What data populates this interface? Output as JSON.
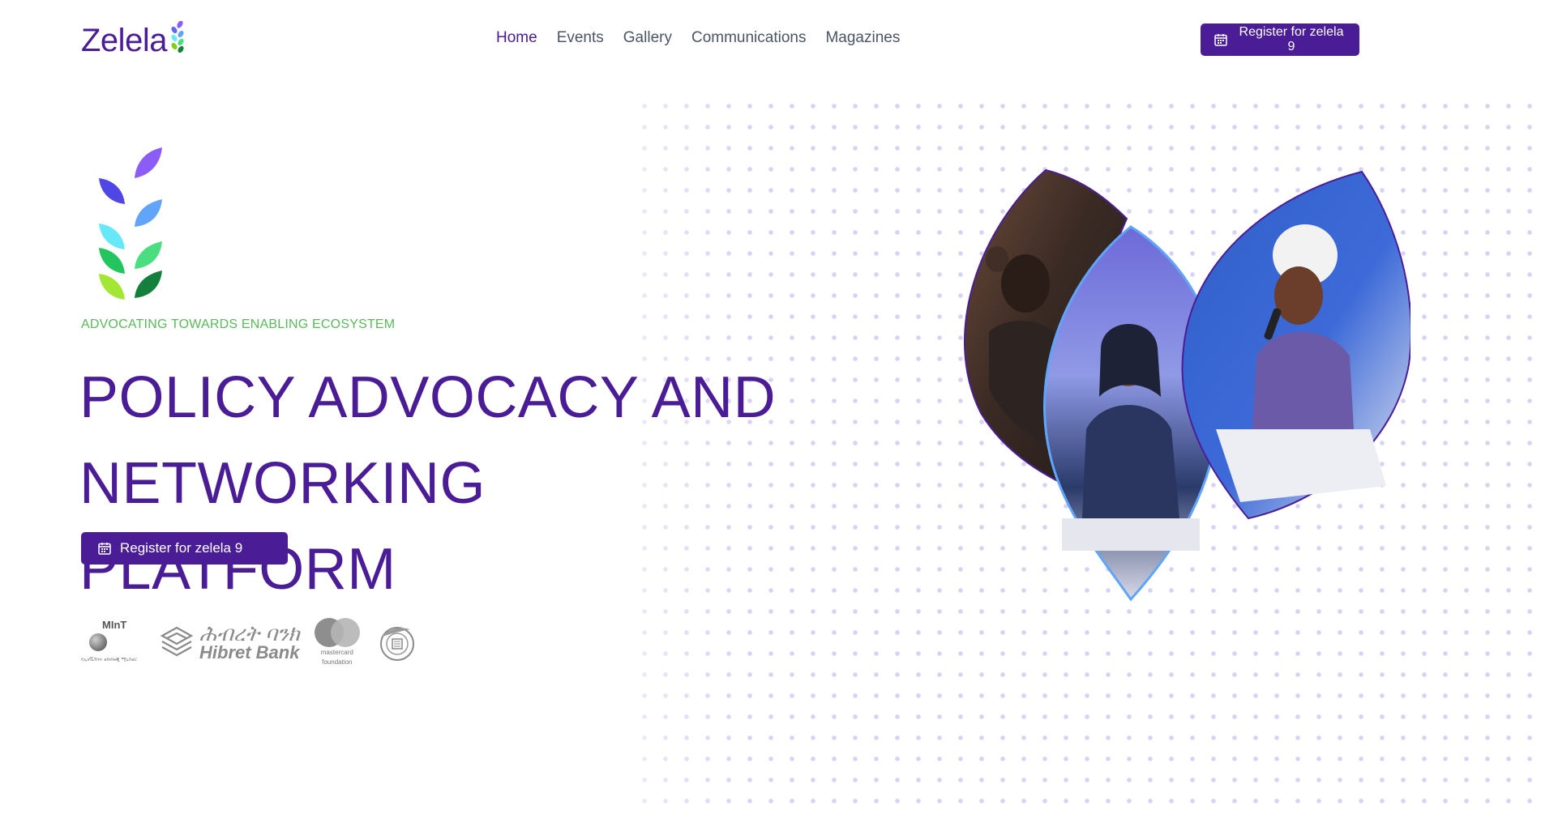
{
  "brand": {
    "name": "Zelela"
  },
  "nav": {
    "items": [
      {
        "label": "Home",
        "active": true
      },
      {
        "label": "Events",
        "active": false
      },
      {
        "label": "Gallery",
        "active": false
      },
      {
        "label": "Communications",
        "active": false
      },
      {
        "label": "Magazines",
        "active": false
      }
    ]
  },
  "header": {
    "register_label": "Register for zelela 9"
  },
  "hero": {
    "tagline": "ADVOCATING TOWARDS ENABLING ECOSYSTEM",
    "headline_line1": "POLICY ADVOCACY AND",
    "headline_line2": "NETWORKING PLATFORM",
    "register_label": "Register for zelela 9"
  },
  "partners": {
    "mint": {
      "title": "MInT",
      "subtitle": "የኢኖቬሽንና ቴክኖሎጂ ሚኒስቴር"
    },
    "hibret": {
      "amharic": "ሕብረት ባንክ",
      "english": "Hibret Bank"
    },
    "mastercard": {
      "line1": "mastercard",
      "line2": "foundation"
    }
  },
  "colors": {
    "primary": "#4a1d96",
    "tagline": "#5cb85c",
    "nav_text": "#4b5563",
    "dots": "#d9d2f4"
  },
  "icons": {
    "calendar": "calendar-icon",
    "brand_mark": "sprout-icon"
  }
}
